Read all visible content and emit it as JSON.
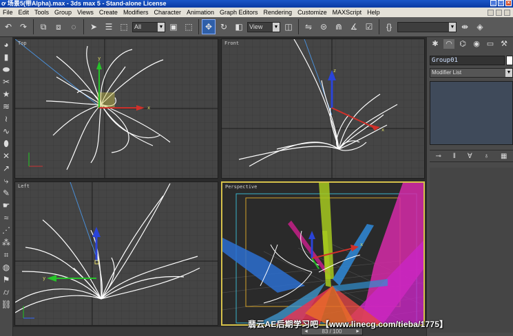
{
  "window": {
    "title": "ơ 场景5(带Alpha).max - 3ds max 5 - Stand-alone License"
  },
  "menu": [
    "File",
    "Edit",
    "Tools",
    "Group",
    "Views",
    "Create",
    "Modifiers",
    "Character",
    "Animation",
    "Graph Editors",
    "Rendering",
    "Customize",
    "MAXScript",
    "Help"
  ],
  "toolbar": {
    "selection_filter": "All",
    "ref_coord": "View",
    "named_selection": ""
  },
  "viewports": {
    "top": "Top",
    "front": "Front",
    "left": "Left",
    "perspective": "Perspective",
    "axis_x": "x",
    "axis_y": "y",
    "axis_z": "z"
  },
  "command_panel": {
    "object_name": "Group01",
    "modifier_list": "Modifier List"
  },
  "timeline": {
    "frame_counter": "83 / 100"
  },
  "watermark": "翡云AE后期学习吧 【www.linecg.com/tieba/1775】"
}
